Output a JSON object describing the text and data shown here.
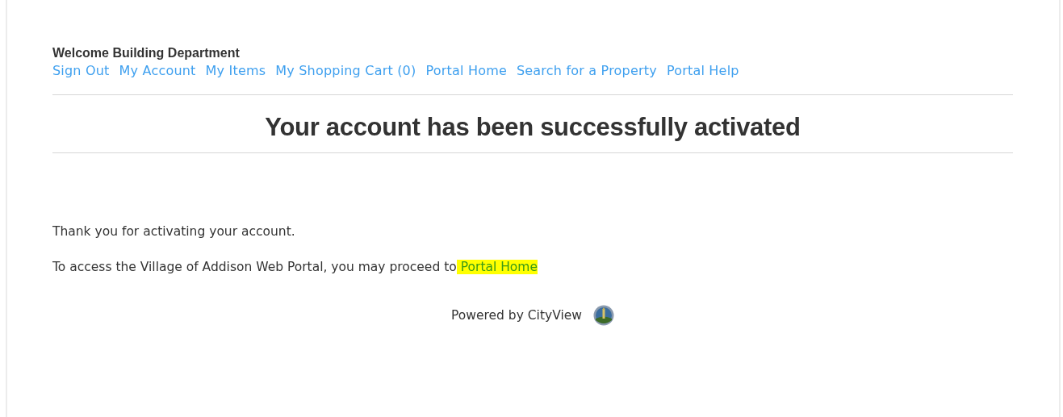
{
  "header": {
    "welcome": "Welcome Building Department",
    "nav_links": [
      "Sign Out",
      "My Account",
      "My Items",
      "My Shopping Cart (0)",
      "Portal Home",
      "Search for a Property",
      "Portal Help"
    ]
  },
  "title": "Your account has been successfully activated",
  "message": "Thank you for activating your account.",
  "access_text": "To access the Village of Addison Web Portal, you may proceed to",
  "access_link": {
    "label": "Portal Home",
    "highlighted": true
  },
  "footer": {
    "text": "Powered by CityView"
  }
}
